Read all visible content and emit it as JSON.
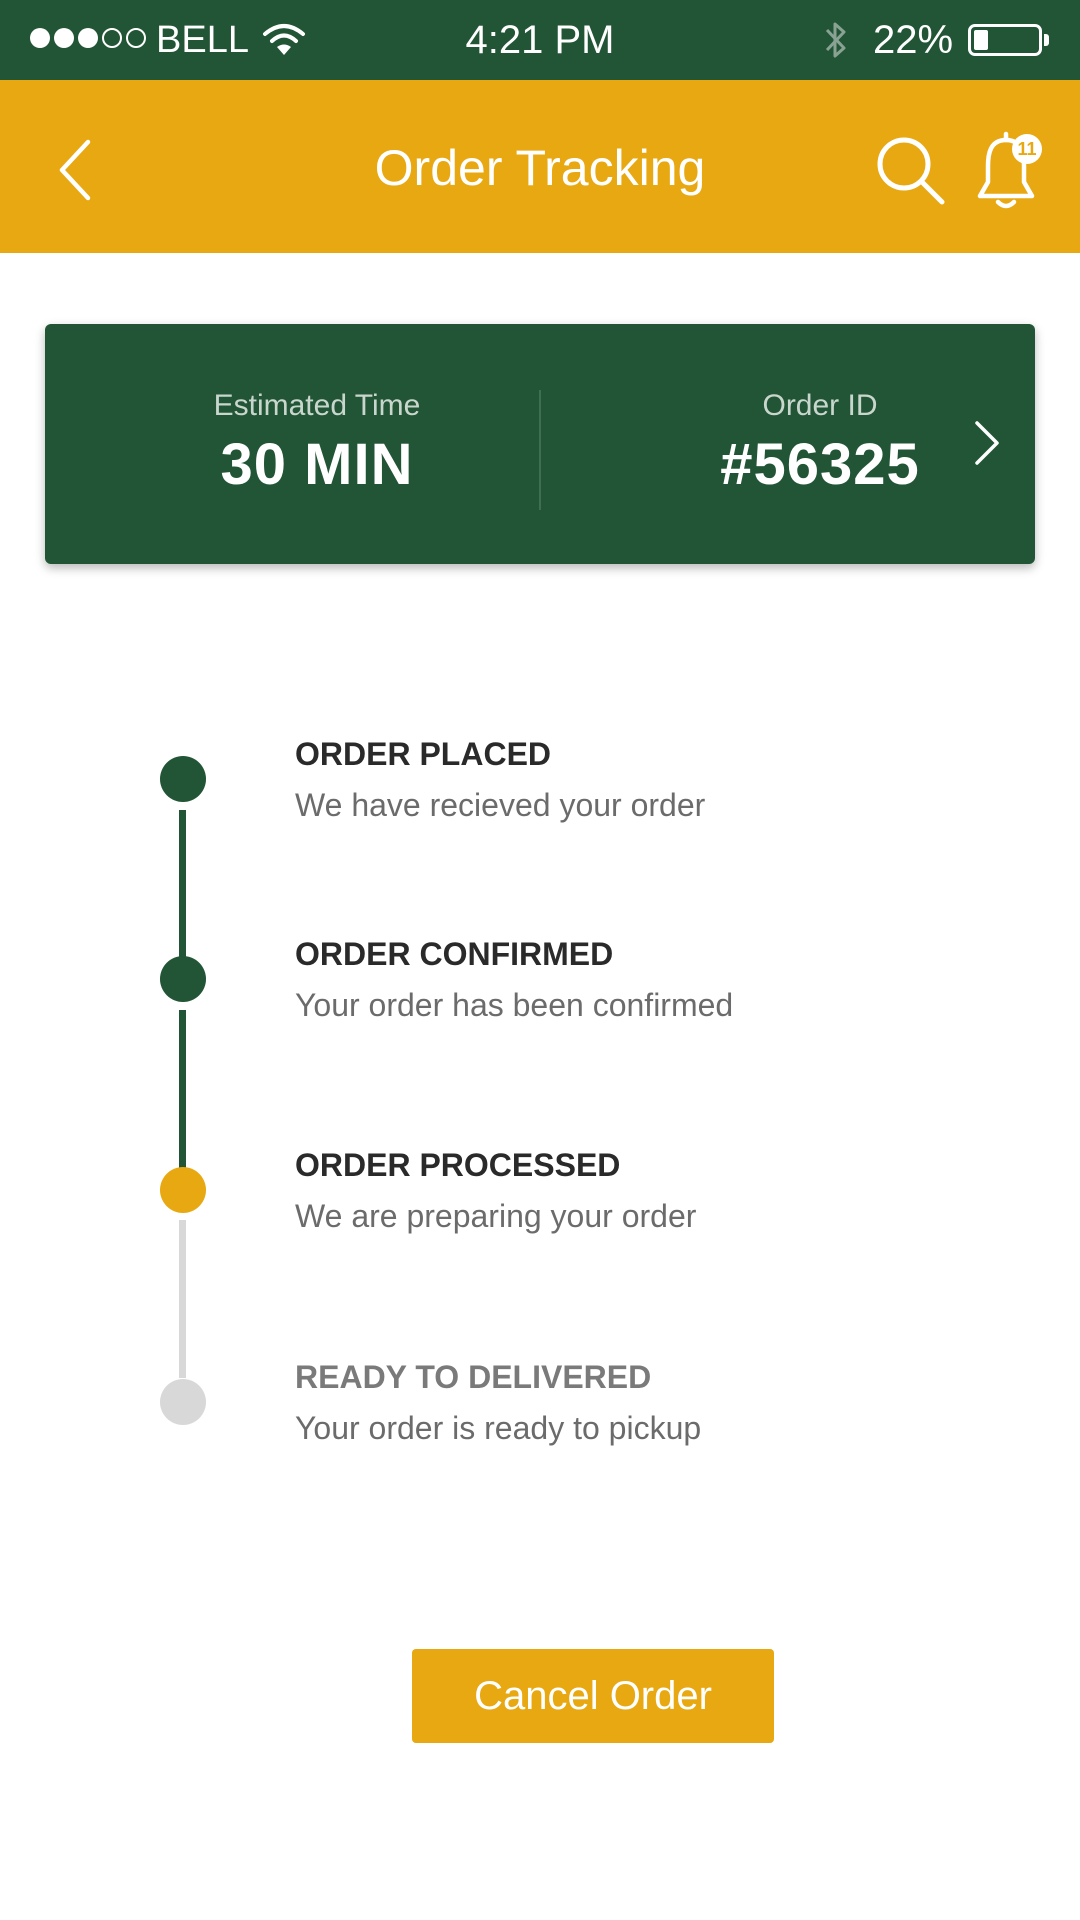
{
  "status_bar": {
    "signal_bars_filled": 3,
    "signal_bars_total": 5,
    "carrier": "BELL",
    "time": "4:21 PM",
    "battery_percent_text": "22%",
    "battery_level": 0.22,
    "icons": [
      "wifi-icon",
      "bluetooth-icon",
      "battery-icon"
    ]
  },
  "header": {
    "title": "Order Tracking",
    "notification_count": "11",
    "icons": [
      "chevron-left-icon",
      "search-icon",
      "bell-icon"
    ]
  },
  "summary": {
    "estimated_label": "Estimated Time",
    "estimated_value": "30 MIN",
    "order_label": "Order ID",
    "order_value": "#56325",
    "icons": [
      "chevron-right-icon"
    ]
  },
  "timeline": {
    "steps": [
      {
        "title": "ORDER PLACED",
        "description": "We have recieved your order",
        "status": "done"
      },
      {
        "title": "ORDER CONFIRMED",
        "description": "Your order has been confirmed",
        "status": "done"
      },
      {
        "title": "ORDER PROCESSED",
        "description": "We are preparing your order",
        "status": "current"
      },
      {
        "title": "READY TO DELIVERED",
        "description": "Your order is ready to pickup",
        "status": "pending"
      }
    ]
  },
  "actions": {
    "cancel_label": "Cancel Order"
  },
  "colors": {
    "primary_green": "#215535",
    "accent_yellow": "#E8A811",
    "pending_grey": "#D8D8D8",
    "white": "#FFFFFF"
  }
}
